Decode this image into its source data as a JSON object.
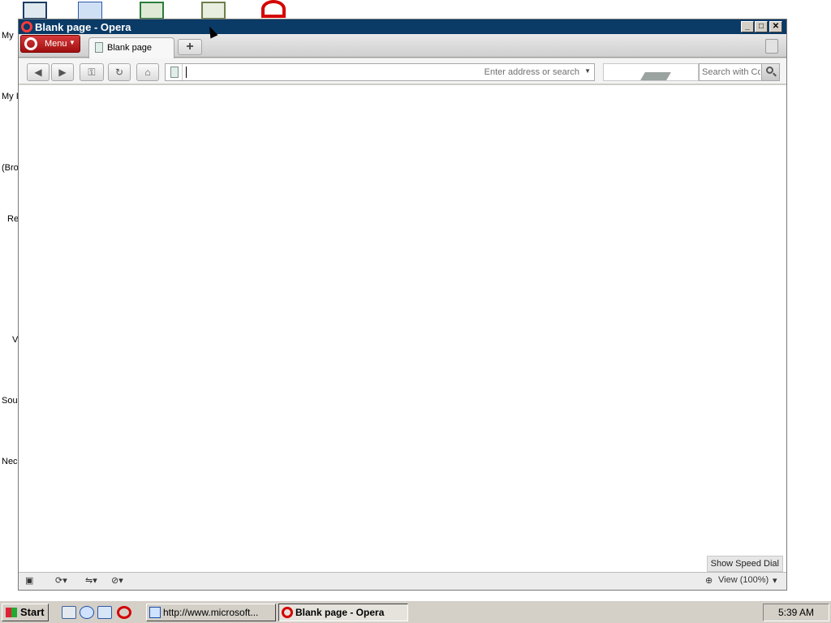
{
  "desktop": {
    "icon_labels": [
      "My",
      "My I",
      "(Bro",
      "Re",
      "V",
      "Sou",
      "Nec"
    ]
  },
  "window": {
    "title": "Blank page - Opera",
    "buttons": {
      "minimize": "_",
      "maximize": "□",
      "close": "✕"
    }
  },
  "tabbar": {
    "menu_label": "Menu",
    "tabs": [
      {
        "label": "Blank page"
      }
    ],
    "new_tab_label": "+"
  },
  "navbar": {
    "address_value": "",
    "address_placeholder": "Enter address or search",
    "search_placeholder": "Search with Co"
  },
  "content": {
    "speed_dial_label": "Show Speed Dial"
  },
  "statusbar": {
    "zoom_label": "View (100%)"
  },
  "taskbar": {
    "start_label": "Start",
    "tasks": [
      {
        "label": "http://www.microsoft..."
      },
      {
        "label": "Blank page - Opera"
      }
    ],
    "clock": "5:39 AM"
  },
  "colors": {
    "titlebar": "#0a3a66",
    "menu_red": "#c21f1f",
    "opera_red": "#d40000"
  }
}
